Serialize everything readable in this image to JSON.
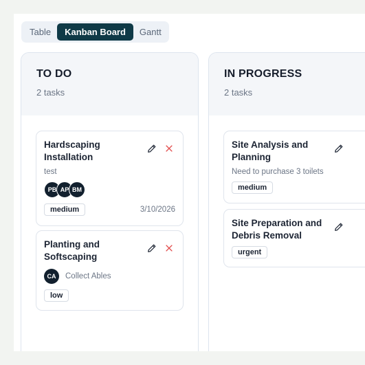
{
  "view_tabs": [
    {
      "label": "Table",
      "active": false
    },
    {
      "label": "Kanban Board",
      "active": true
    },
    {
      "label": "Gantt",
      "active": false
    }
  ],
  "columns": [
    {
      "title": "TO DO",
      "count": "2 tasks",
      "cards": [
        {
          "title": "Hardscaping Installation",
          "description": "test",
          "avatars": [
            "PB",
            "AP",
            "BM"
          ],
          "priority": "medium",
          "due": "3/10/2026"
        },
        {
          "title": "Planting and Softscaping",
          "assignee_initials": "CA",
          "assignee_name": "Collect Ables",
          "priority": "low"
        }
      ]
    },
    {
      "title": "IN PROGRESS",
      "count": "2 tasks",
      "cards": [
        {
          "title": "Site Analysis and Planning",
          "description": "Need to purchase 3 toilets",
          "priority": "medium"
        },
        {
          "title": "Site Preparation and Debris Removal",
          "priority": "urgent"
        }
      ]
    }
  ],
  "colors": {
    "accent": "#0f3a47",
    "delete": "#e24b4b",
    "avatar": "#12202e",
    "column_header": "#f4f6f9"
  },
  "icons": {
    "edit": "pencil-icon",
    "delete": "close-icon"
  }
}
